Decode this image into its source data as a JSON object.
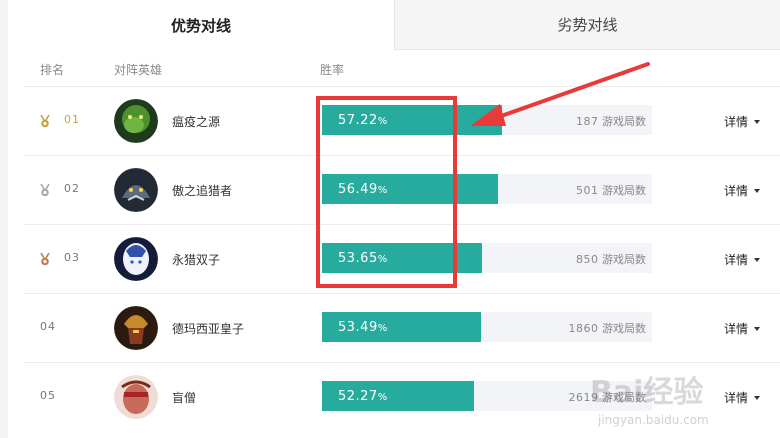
{
  "tabs": {
    "advantage": "优势对线",
    "disadvantage": "劣势对线"
  },
  "columns": {
    "rank": "排名",
    "hero": "对阵英雄",
    "winrate": "胜率"
  },
  "rows": [
    {
      "rank": "01",
      "medal": "gold",
      "hero": "瘟疫之源",
      "pct": "57.22",
      "pct_unit": "%",
      "winrate": 0.5722,
      "games_count": "187",
      "games_label": "游戏局数",
      "detail": "详情"
    },
    {
      "rank": "02",
      "medal": "silver",
      "hero": "傲之追猎者",
      "pct": "56.49",
      "pct_unit": "%",
      "winrate": 0.5649,
      "games_count": "501",
      "games_label": "游戏局数",
      "detail": "详情"
    },
    {
      "rank": "03",
      "medal": "bronze",
      "hero": "永猎双子",
      "pct": "53.65",
      "pct_unit": "%",
      "winrate": 0.5365,
      "games_count": "850",
      "games_label": "游戏局数",
      "detail": "详情"
    },
    {
      "rank": "04",
      "medal": "",
      "hero": "德玛西亚皇子",
      "pct": "53.49",
      "pct_unit": "%",
      "winrate": 0.5349,
      "games_count": "1860",
      "games_label": "游戏局数",
      "detail": "详情"
    },
    {
      "rank": "05",
      "medal": "",
      "hero": "盲僧",
      "pct": "52.27",
      "pct_unit": "%",
      "winrate": 0.5227,
      "games_count": "2619",
      "games_label": "游戏局数",
      "detail": "详情"
    }
  ],
  "colors": {
    "accent": "#27ab9e",
    "highlight": "#e93a3a",
    "gold": "#c9a23a"
  },
  "watermark": {
    "text": "Bai经验",
    "sub": "jingyan.baidu.com"
  }
}
